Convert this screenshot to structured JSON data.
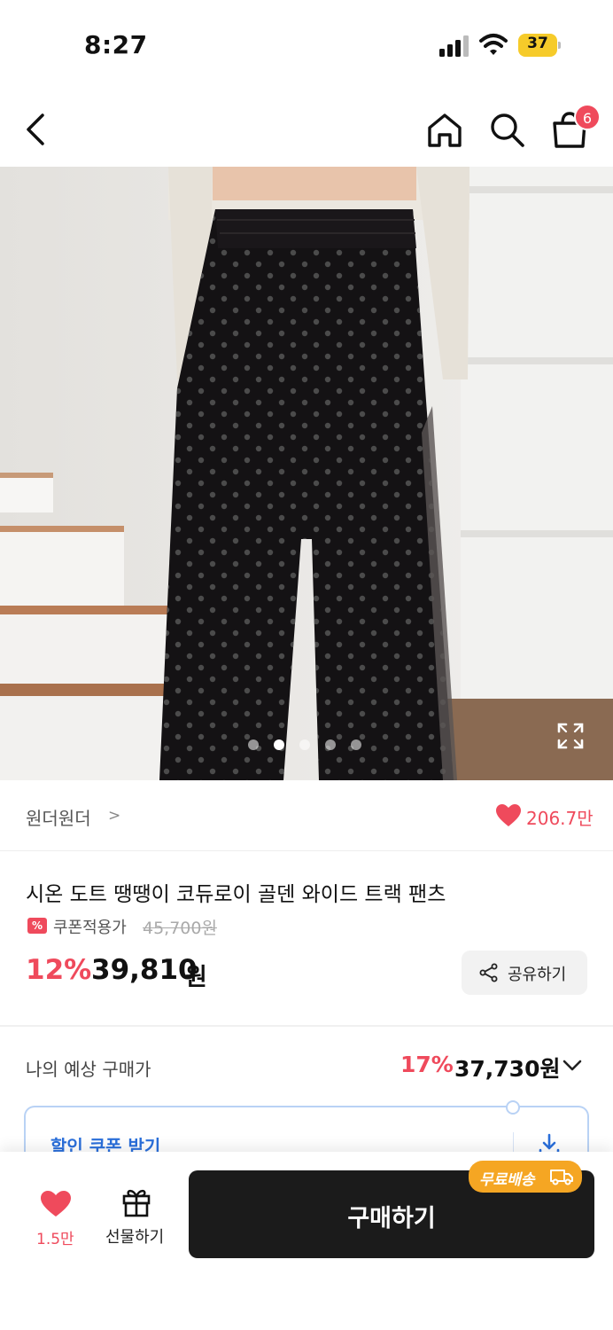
{
  "status_bar": {
    "time": "8:27",
    "battery_level": "37"
  },
  "nav": {
    "cart_count": "6"
  },
  "hero": {
    "image_count": 5,
    "active_index": 1
  },
  "brand": {
    "name": "원더원더",
    "chevron": ">",
    "like_count": "206.7만"
  },
  "product": {
    "title": "시온 도트 땡땡이 코듀로이 골덴 와이드 트랙 팬츠",
    "coupon_label": "쿠폰적용가",
    "coupon_tag_icon": "%",
    "original_price": "45,700원",
    "discount": "12%",
    "price": "39,810",
    "price_unit": "원",
    "share_label": "공유하기"
  },
  "expected": {
    "label": "나의 예상 구매가",
    "discount": "17%",
    "price": "37,730원"
  },
  "coupon_card": {
    "label": "할인 쿠폰 받기"
  },
  "bottom_bar": {
    "wish_count": "1.5만",
    "gift_label": "선물하기",
    "buy_label": "구매하기",
    "free_shipping_label": "무료배송"
  },
  "colors": {
    "accent_red": "#ef4a5c",
    "coupon_blue": "#2a6fdb",
    "free_ship_orange": "#f5a623",
    "buy_button": "#1b1b1b"
  }
}
